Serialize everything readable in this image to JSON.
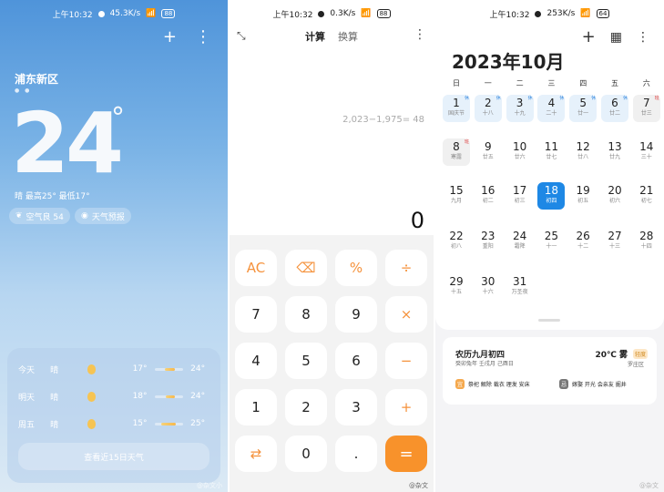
{
  "weather": {
    "status": {
      "time": "上午10:32",
      "speed": "45.3K/s",
      "signal": "5G",
      "battery": "88"
    },
    "add_icon": "+",
    "more_icon": "⋮",
    "city": "浦东新区",
    "temperature": "24",
    "degree_symbol": "°",
    "description": "晴  最高25° 最低17°",
    "air_quality": "空气良 54",
    "weather_alert": "天气预报",
    "forecast": [
      {
        "day": "今天",
        "condition": "晴",
        "low": "17°",
        "high": "24°",
        "low_value": 17,
        "high_value": 24
      },
      {
        "day": "明天",
        "condition": "晴",
        "low": "18°",
        "high": "24°",
        "low_value": 18,
        "high_value": 24
      },
      {
        "day": "周五",
        "condition": "晴",
        "low": "15°",
        "high": "25°",
        "low_value": 15,
        "high_value": 25
      }
    ],
    "forecast_button": "查看近15日天气",
    "watermark": "@杂文小"
  },
  "calculator": {
    "status": {
      "time": "上午10:32",
      "speed": "0.3K/s",
      "signal": "5G",
      "battery": "88"
    },
    "tabs": [
      "计算",
      "换算"
    ],
    "expression": "2,023−1,975= 48",
    "result": "0",
    "keys": [
      [
        "AC",
        "⌫",
        "%",
        "÷"
      ],
      [
        "7",
        "8",
        "9",
        "×"
      ],
      [
        "4",
        "5",
        "6",
        "−"
      ],
      [
        "1",
        "2",
        "3",
        "+"
      ],
      [
        "⇄",
        "0",
        ".",
        "="
      ]
    ],
    "watermark": "@杂文"
  },
  "calendar": {
    "status": {
      "time": "上午10:32",
      "speed": "253K/s",
      "signal": "5G",
      "battery": "64"
    },
    "title": "2023年10月",
    "weekdays": [
      "日",
      "一",
      "二",
      "三",
      "四",
      "五",
      "六"
    ],
    "days": [
      {
        "n": "1",
        "l": "国庆节",
        "t": "hol",
        "tag": "休"
      },
      {
        "n": "2",
        "l": "十八",
        "t": "hol",
        "tag": "休"
      },
      {
        "n": "3",
        "l": "十九",
        "t": "hol",
        "tag": "休"
      },
      {
        "n": "4",
        "l": "二十",
        "t": "hol",
        "tag": "休"
      },
      {
        "n": "5",
        "l": "廿一",
        "t": "hol",
        "tag": "休"
      },
      {
        "n": "6",
        "l": "廿二",
        "t": "hol",
        "tag": "休"
      },
      {
        "n": "7",
        "l": "廿三",
        "t": "work",
        "tag": "班"
      },
      {
        "n": "8",
        "l": "寒露",
        "t": "work",
        "tag": "班"
      },
      {
        "n": "9",
        "l": "廿五",
        "t": "",
        "tag": ""
      },
      {
        "n": "10",
        "l": "廿六",
        "t": "",
        "tag": ""
      },
      {
        "n": "11",
        "l": "廿七",
        "t": "",
        "tag": ""
      },
      {
        "n": "12",
        "l": "廿八",
        "t": "",
        "tag": ""
      },
      {
        "n": "13",
        "l": "廿九",
        "t": "",
        "tag": ""
      },
      {
        "n": "14",
        "l": "三十",
        "t": "",
        "tag": ""
      },
      {
        "n": "15",
        "l": "九月",
        "t": "",
        "tag": ""
      },
      {
        "n": "16",
        "l": "初二",
        "t": "",
        "tag": ""
      },
      {
        "n": "17",
        "l": "初三",
        "t": "",
        "tag": ""
      },
      {
        "n": "18",
        "l": "初四",
        "t": "today",
        "tag": ""
      },
      {
        "n": "19",
        "l": "初五",
        "t": "",
        "tag": ""
      },
      {
        "n": "20",
        "l": "初六",
        "t": "",
        "tag": ""
      },
      {
        "n": "21",
        "l": "初七",
        "t": "",
        "tag": ""
      },
      {
        "n": "22",
        "l": "初八",
        "t": "",
        "tag": ""
      },
      {
        "n": "23",
        "l": "重阳",
        "t": "",
        "tag": ""
      },
      {
        "n": "24",
        "l": "霜降",
        "t": "",
        "tag": ""
      },
      {
        "n": "25",
        "l": "十一",
        "t": "",
        "tag": ""
      },
      {
        "n": "26",
        "l": "十二",
        "t": "",
        "tag": ""
      },
      {
        "n": "27",
        "l": "十三",
        "t": "",
        "tag": ""
      },
      {
        "n": "28",
        "l": "十四",
        "t": "",
        "tag": ""
      },
      {
        "n": "29",
        "l": "十五",
        "t": "",
        "tag": ""
      },
      {
        "n": "30",
        "l": "十六",
        "t": "",
        "tag": ""
      },
      {
        "n": "31",
        "l": "万圣夜",
        "t": "",
        "tag": ""
      }
    ],
    "lunar_date": "农历九月初四",
    "ganzhi": "癸卯兔年 壬戌月 己酉日",
    "weather_temp": "20℃ 雾",
    "air_badge": "轻度",
    "location": "罗庄区",
    "yi_label": "宜",
    "yi": "祭祀 解除 裁衣 理发 安床",
    "ji_label": "忌",
    "ji": "嫁娶 开光 会亲友 掘井",
    "watermark": "@杂文"
  }
}
